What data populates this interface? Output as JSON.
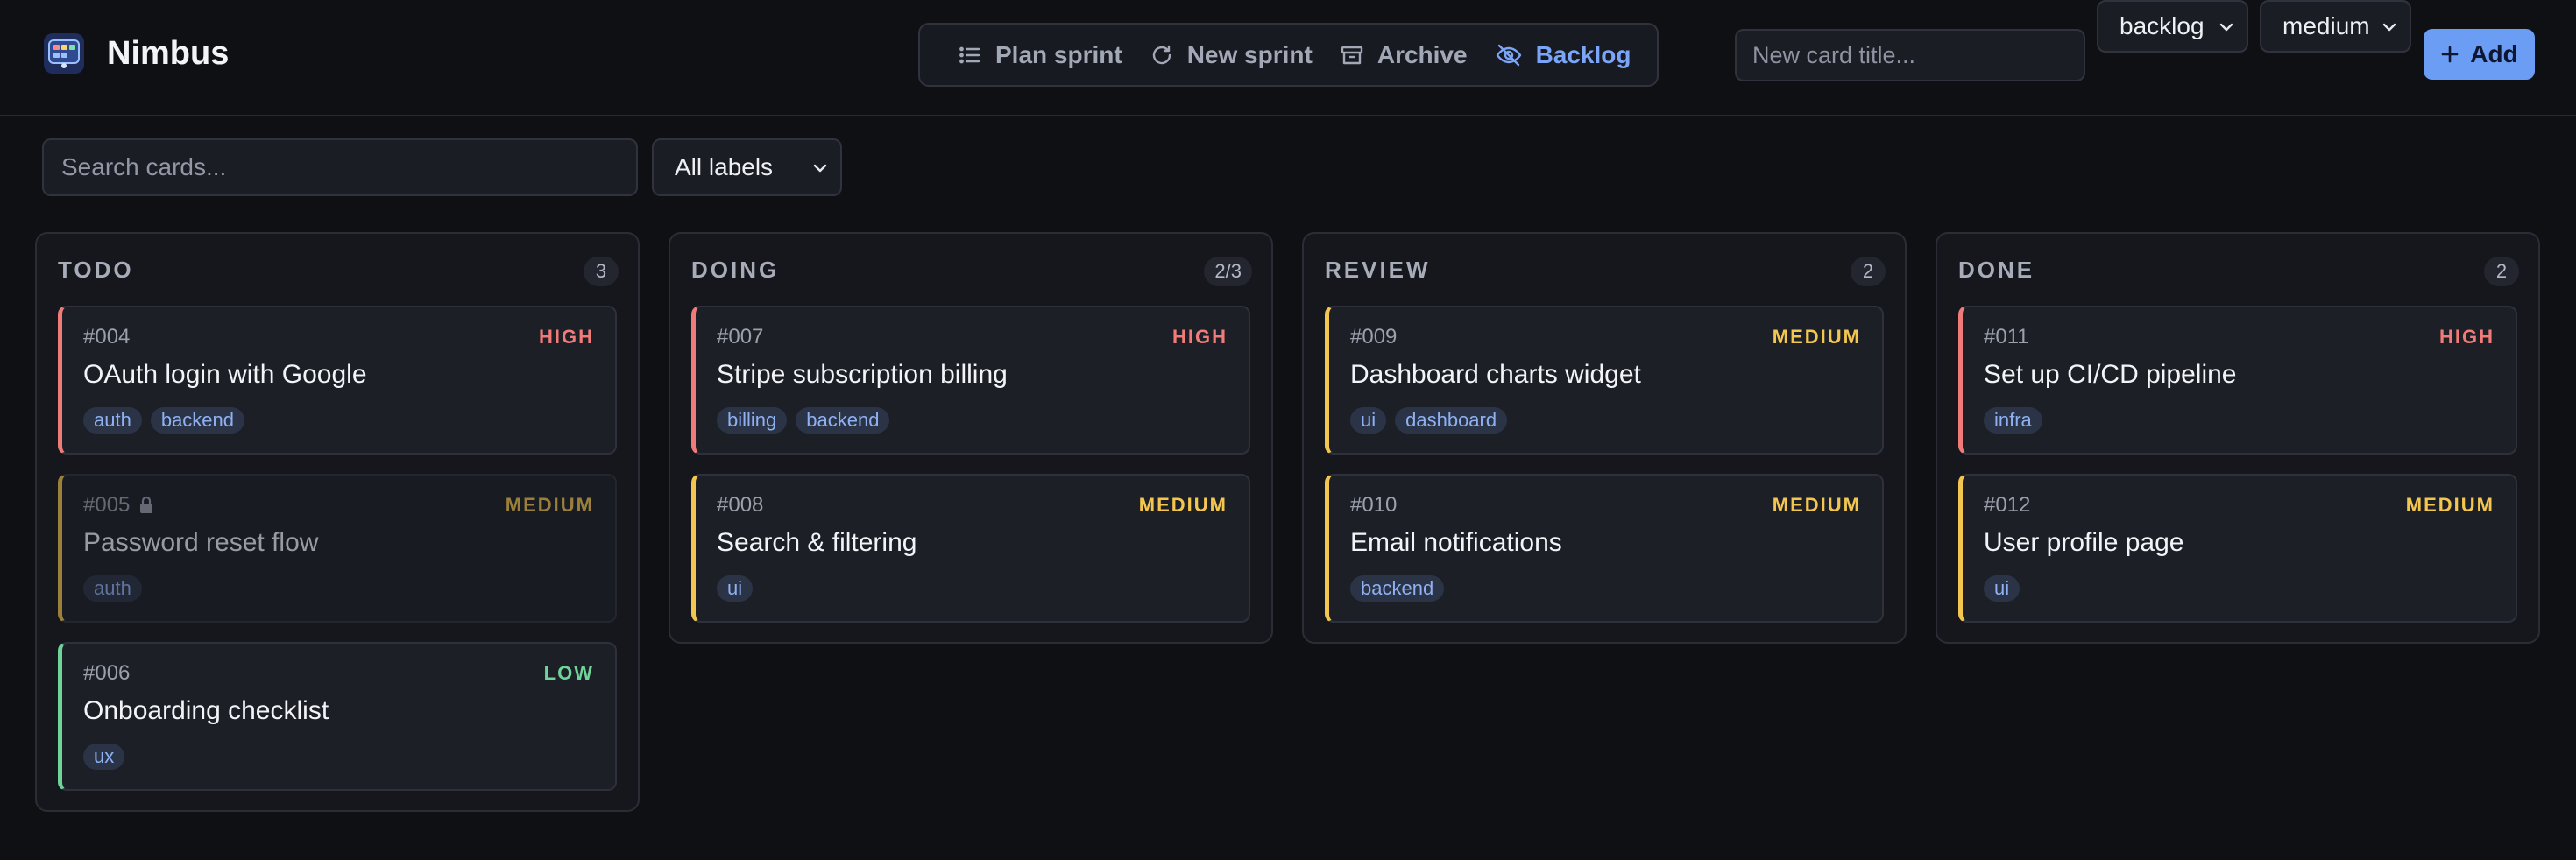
{
  "app": {
    "name": "Nimbus"
  },
  "toolbar": {
    "plan_sprint": "Plan sprint",
    "new_sprint": "New sprint",
    "archive": "Archive",
    "backlog": "Backlog"
  },
  "new_card": {
    "placeholder": "New card title...",
    "column_value": "backlog",
    "priority_value": "medium",
    "add_label": "Add"
  },
  "filters": {
    "search_placeholder": "Search cards...",
    "labels_value": "All labels"
  },
  "priority_colors": {
    "HIGH": "#f07b78",
    "MEDIUM": "#f3c64f",
    "LOW": "#6fd39a"
  },
  "accent": "#6b9df5",
  "columns": [
    {
      "title": "TODO",
      "count": "3",
      "cards": [
        {
          "id": "#004",
          "title": "OAuth login with Google",
          "priority": "HIGH",
          "tags": [
            "auth",
            "backend"
          ]
        },
        {
          "id": "#005",
          "title": "Password reset flow",
          "priority": "MEDIUM",
          "tags": [
            "auth"
          ],
          "locked": true
        },
        {
          "id": "#006",
          "title": "Onboarding checklist",
          "priority": "LOW",
          "tags": [
            "ux"
          ]
        }
      ]
    },
    {
      "title": "DOING",
      "count": "2/3",
      "cards": [
        {
          "id": "#007",
          "title": "Stripe subscription billing",
          "priority": "HIGH",
          "tags": [
            "billing",
            "backend"
          ]
        },
        {
          "id": "#008",
          "title": "Search & filtering",
          "priority": "MEDIUM",
          "tags": [
            "ui"
          ]
        }
      ]
    },
    {
      "title": "REVIEW",
      "count": "2",
      "cards": [
        {
          "id": "#009",
          "title": "Dashboard charts widget",
          "priority": "MEDIUM",
          "tags": [
            "ui",
            "dashboard"
          ]
        },
        {
          "id": "#010",
          "title": "Email notifications",
          "priority": "MEDIUM",
          "tags": [
            "backend"
          ]
        }
      ]
    },
    {
      "title": "DONE",
      "count": "2",
      "cards": [
        {
          "id": "#011",
          "title": "Set up CI/CD pipeline",
          "priority": "HIGH",
          "tags": [
            "infra"
          ]
        },
        {
          "id": "#012",
          "title": "User profile page",
          "priority": "MEDIUM",
          "tags": [
            "ui"
          ]
        }
      ]
    }
  ]
}
